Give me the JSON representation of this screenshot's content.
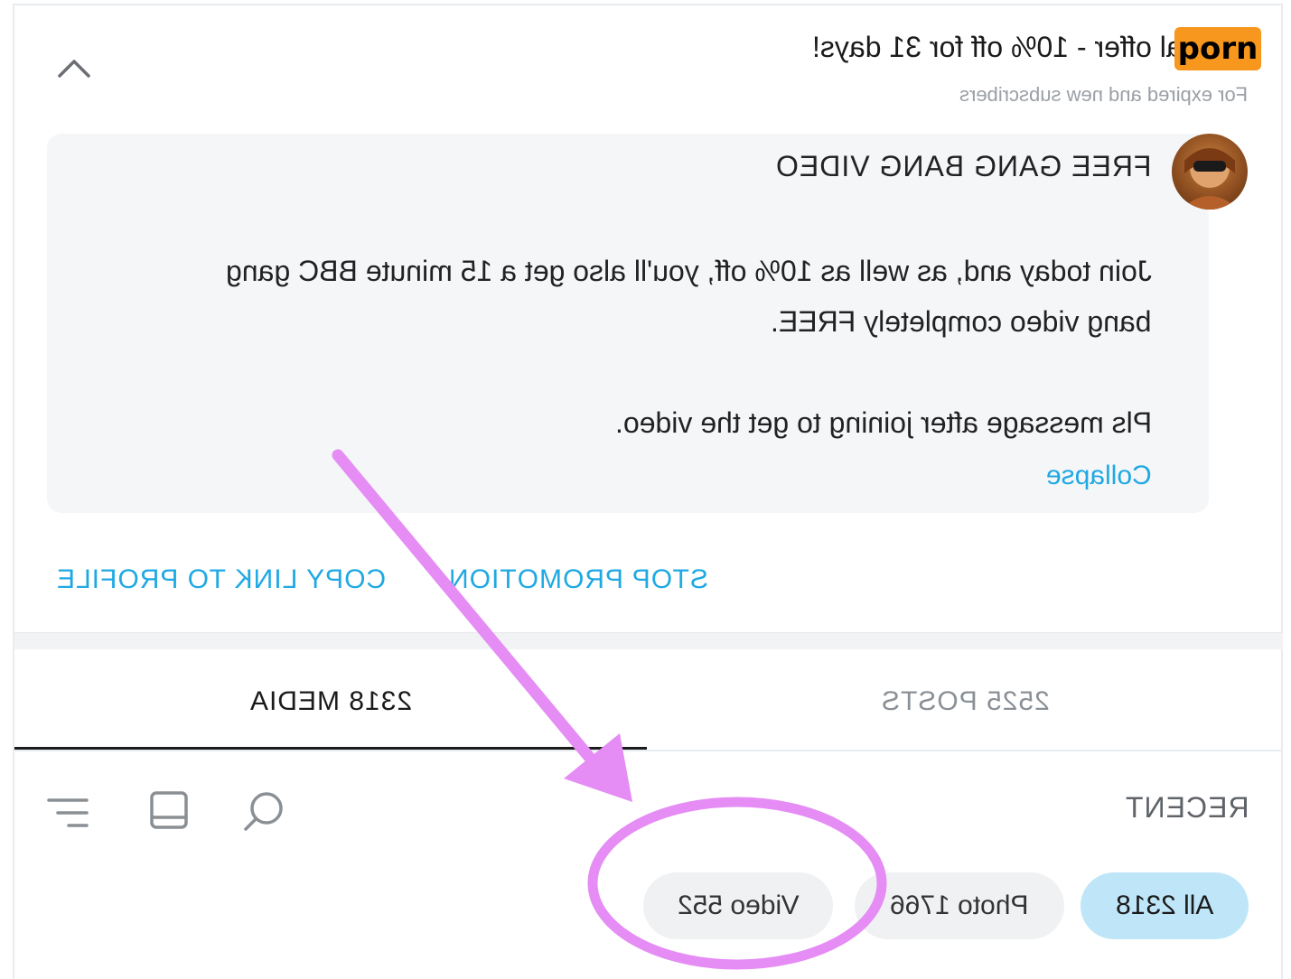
{
  "watermark": {
    "text": "porn",
    "color": "#f7971d"
  },
  "offer": {
    "title": "Special offer - 10% off for 31 days!",
    "subtitle": "For expired and new subscribers"
  },
  "promo": {
    "heading": "FREE GANG BANG VIDEO",
    "line1": "Join today and, as well as 10% off, you'll also get a 15 minute BBC gang",
    "line2": "bang video completely FREE.",
    "line3": "Pls message after joining to get the video.",
    "collapse_label": "Collapse"
  },
  "actions": {
    "copy_link_label": "COPY LINK TO PROFILE",
    "stop_promotion_label": "STOP PROMOTION"
  },
  "tabs": [
    {
      "label": "2318 MEDIA",
      "active": true
    },
    {
      "label": "2525 POSTS",
      "active": false
    }
  ],
  "toolbar": {
    "sort_label": "RECENT",
    "icons": [
      "sort-lines-icon",
      "layout-grid-icon",
      "search-icon"
    ]
  },
  "filters": [
    {
      "label": "All 2318",
      "selected": true
    },
    {
      "label": "Photo 1766",
      "selected": false
    },
    {
      "label": "Video 552",
      "selected": false
    }
  ],
  "colors": {
    "accent": "#1fa9e3",
    "pill_selected": "#bfe6f8",
    "pill": "#f0f1f3",
    "annotation": "#e58cf5"
  }
}
